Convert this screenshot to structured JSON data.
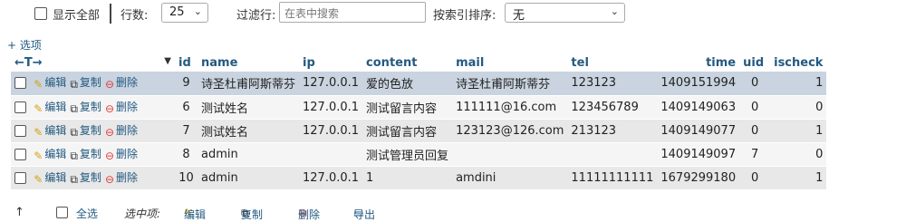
{
  "topbar": {
    "show_all": "显示全部",
    "rows_label": "行数:",
    "rows_value": "25",
    "filter_label": "过滤行:",
    "filter_placeholder": "在表中搜索",
    "sort_label": "按索引排序:",
    "sort_value": "无"
  },
  "options_link": "+ 选项",
  "header": {
    "arrows": "←T→",
    "cols": [
      "id",
      "name",
      "ip",
      "content",
      "mail",
      "tel",
      "time",
      "uid",
      "ischeck"
    ]
  },
  "actions": {
    "edit": "编辑",
    "copy": "复制",
    "delete": "删除"
  },
  "rows": [
    {
      "id": "9",
      "name": "诗圣杜甫阿斯蒂芬",
      "ip": "127.0.0.1",
      "content": "爱的色放",
      "mail": "诗圣杜甫阿斯蒂芬",
      "tel": "123123",
      "time": "1409151994",
      "uid": "0",
      "ischeck": "1"
    },
    {
      "id": "6",
      "name": "测试姓名",
      "ip": "127.0.0.1",
      "content": "测试留言内容",
      "mail": "111111@16.com",
      "tel": "123456789",
      "time": "1409149063",
      "uid": "0",
      "ischeck": "0"
    },
    {
      "id": "7",
      "name": "测试姓名",
      "ip": "127.0.0.1",
      "content": "测试留言内容",
      "mail": "123123@126.com",
      "tel": "213123",
      "time": "1409149077",
      "uid": "0",
      "ischeck": "1"
    },
    {
      "id": "8",
      "name": "admin",
      "ip": "",
      "content": "测试管理员回复",
      "mail": "",
      "tel": "",
      "time": "1409149097",
      "uid": "7",
      "ischeck": "0"
    },
    {
      "id": "10",
      "name": "admin",
      "ip": "127.0.0.1",
      "content": "1",
      "mail": "amdini",
      "tel": "11111111111",
      "time": "1679299180",
      "uid": "0",
      "ischeck": "1"
    }
  ],
  "footer": {
    "select_all": "全选",
    "selected_label": "选中项:",
    "edit": "编辑",
    "copy": "复制",
    "delete": "删除",
    "export": "导出"
  },
  "colors": {
    "link": "#235a81",
    "highlight": "#c9d4e0",
    "delete_red": "#e0403a"
  }
}
